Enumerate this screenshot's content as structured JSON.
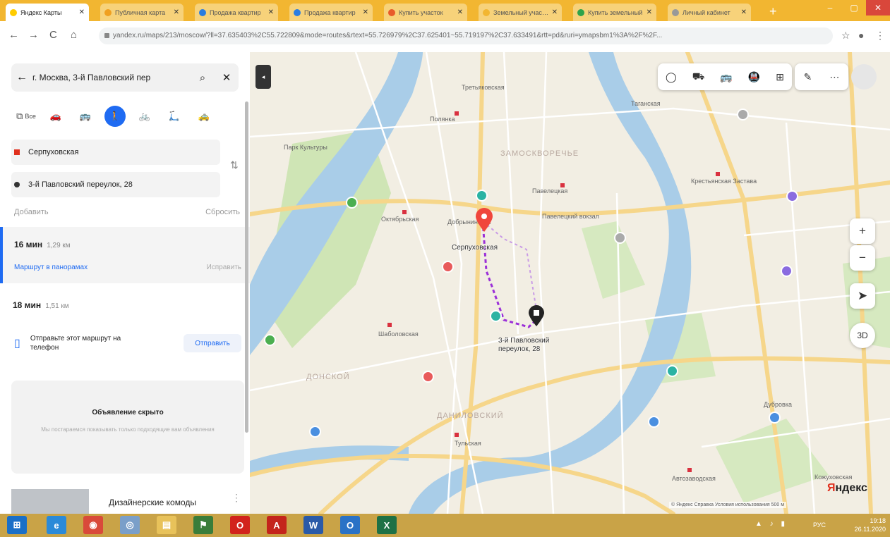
{
  "browser": {
    "tabs": [
      {
        "title": "Яндекс Карты",
        "color": "#ffcc00",
        "active": true
      },
      {
        "title": "Публичная карта",
        "color": "#f0a020"
      },
      {
        "title": "Продажа квартир",
        "color": "#2a7de1"
      },
      {
        "title": "Продажа квартир",
        "color": "#2a7de1"
      },
      {
        "title": "Купить участок",
        "color": "#e85a2a"
      },
      {
        "title": "Земельный участок",
        "color": "#f2b631"
      },
      {
        "title": "Купить земельный",
        "color": "#2fa34a"
      },
      {
        "title": "Личный кабинет",
        "color": "#999999"
      }
    ],
    "new_tab": "+",
    "win_controls": {
      "minimize": "–",
      "maximize": "▢",
      "close": "✕"
    },
    "url": "yandex.ru/maps/213/moscow/?ll=37.635403%2C55.722809&mode=routes&rtext=55.726979%2C37.625401~55.719197%2C37.633491&rtt=pd&ruri=ymapsbm1%3A%2F%2F...",
    "nav": {
      "back": "←",
      "forward": "→",
      "reload": "C",
      "home": "⌂"
    },
    "toolbar": {
      "star": "☆",
      "profile": "●",
      "menu": "⋮"
    }
  },
  "panel": {
    "search": {
      "back": "←",
      "text": "г. Москва, 3-й Павловский пер",
      "search_icon": "⌕",
      "close": "✕"
    },
    "modes": [
      {
        "name": "all",
        "label": "Все",
        "glyph": "⧉"
      },
      {
        "name": "car",
        "glyph": "🚗"
      },
      {
        "name": "transit",
        "glyph": "🚌"
      },
      {
        "name": "walk",
        "glyph": "🚶",
        "active": true
      },
      {
        "name": "bike",
        "glyph": "🚲"
      },
      {
        "name": "scooter",
        "glyph": "🛴"
      },
      {
        "name": "taxi",
        "glyph": "🚕"
      }
    ],
    "from": "Серпуховская",
    "to": "3-й Павловский переулок, 28",
    "from_color": "#e0301e",
    "to_color": "#333333",
    "swap": "⇅",
    "add_label": "Добавить",
    "reset_label": "Сбросить",
    "routes": [
      {
        "time": "16 мин",
        "distance": "1,29 км",
        "link": "Маршрут в панорамах",
        "action": "Исправить"
      },
      {
        "time": "18 мин",
        "distance": "1,51 км"
      }
    ],
    "send": {
      "text": "Отправьте этот маршрут на телефон",
      "button": "Отправить"
    },
    "ad": {
      "title": "Объявление скрыто",
      "subtitle": "Мы постараемся показывать только подходящие вам объявления"
    },
    "promo": {
      "text": "Дизайнерские комоды",
      "more": "⋮"
    }
  },
  "map": {
    "districts": [
      "ЗАМОСКВОРЕЧЬЕ",
      "ДОНСКОЙ",
      "ДАНИЛОВСКИЙ"
    ],
    "labels": [
      "Третьяковская",
      "Полянка",
      "Парк Культуры",
      "Октябрьская",
      "Добрынинская",
      "Павелецкая",
      "Павелецкий вокзал",
      "Таганская",
      "Крестьянская Застава",
      "Шаболовская",
      "Тульская",
      "Автозаводская",
      "Дубровка",
      "Кожуховская"
    ],
    "origin_label": "Серпуховская",
    "dest_label": "3-й Павловский переулок, 28",
    "top_tools": [
      "◯",
      "⛟",
      "🚌",
      "🚇",
      "⊞"
    ],
    "top_tools2": [
      "✎",
      "⋯"
    ],
    "controls": {
      "zoom_in": "+",
      "zoom_out": "−",
      "locate": "➤",
      "view3d": "3D"
    },
    "collapse": "◂",
    "logo_first": "Я",
    "logo_rest": "ндекс",
    "footer": "© Яндекс  Справка  Условия использования  500 м"
  },
  "taskbar": {
    "apps": [
      {
        "name": "start",
        "glyph": "⊞",
        "color": "#1a6fc7"
      },
      {
        "name": "ie",
        "glyph": "e",
        "color": "#2b8ad8"
      },
      {
        "name": "chrome",
        "glyph": "◉",
        "color": "#d94a3a"
      },
      {
        "name": "media",
        "glyph": "◎",
        "color": "#7a9fc9"
      },
      {
        "name": "explorer",
        "glyph": "▤",
        "color": "#e8c25a"
      },
      {
        "name": "acrobat-reader",
        "glyph": "⚑",
        "color": "#3a7d3a"
      },
      {
        "name": "opera",
        "glyph": "O",
        "color": "#d2231c"
      },
      {
        "name": "acrobat",
        "glyph": "A",
        "color": "#c4241b"
      },
      {
        "name": "word",
        "glyph": "W",
        "color": "#2a5aa8"
      },
      {
        "name": "outlook",
        "glyph": "O",
        "color": "#2a72c6"
      },
      {
        "name": "excel",
        "glyph": "X",
        "color": "#1e7145"
      }
    ],
    "lang": "РУС",
    "time": "19:18",
    "date": "26.11.2020"
  }
}
